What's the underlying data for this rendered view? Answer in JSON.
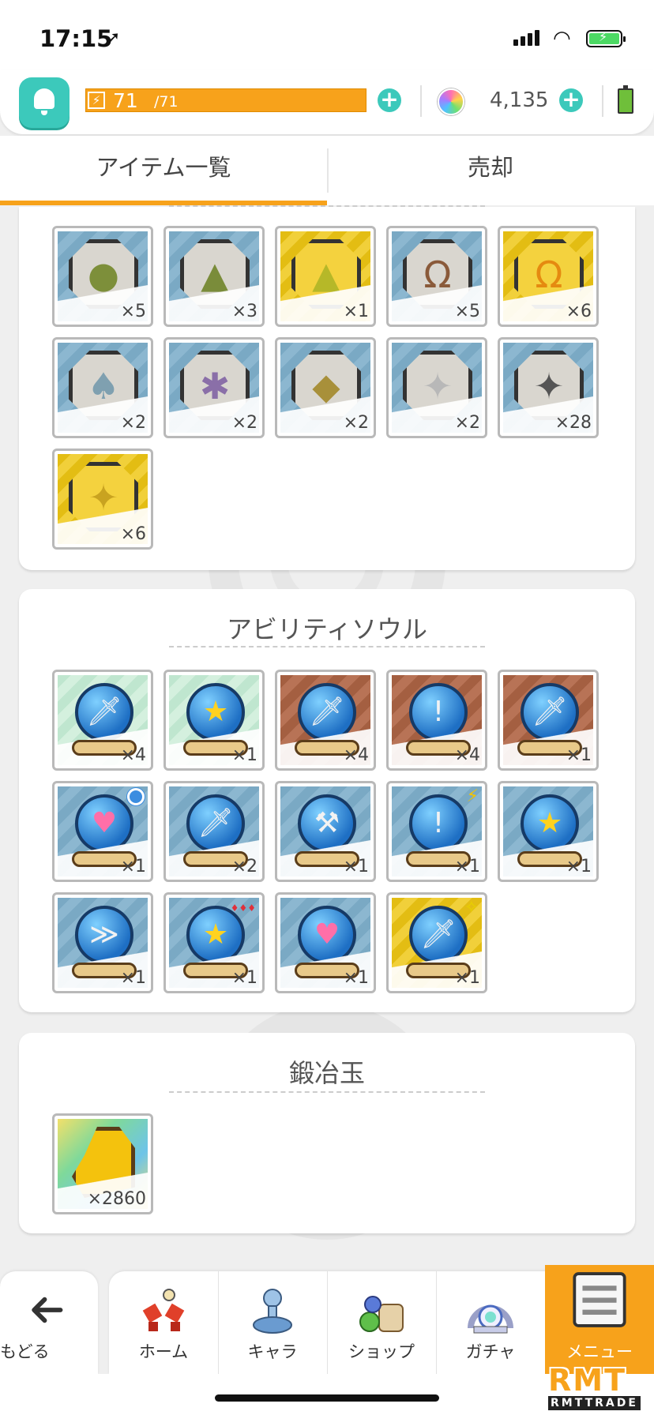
{
  "status": {
    "time": "17:15"
  },
  "header": {
    "stamina_current": "71",
    "stamina_max": "/71",
    "stamina_fraction": 1.0,
    "orb_count": "4,135"
  },
  "tabs": [
    {
      "label": "アイテム一覧",
      "active": true
    },
    {
      "label": "売却",
      "active": false
    }
  ],
  "medals": {
    "items": [
      {
        "bg": "blue",
        "count": "×5",
        "icon": "slime-medal-icon",
        "glyph": "●",
        "color": "#7d8f3a"
      },
      {
        "bg": "blue",
        "count": "×3",
        "icon": "squid-medal-icon",
        "glyph": "▲",
        "color": "#7a8c3a"
      },
      {
        "bg": "gold",
        "count": "×1",
        "icon": "squid-medal-icon",
        "glyph": "▲",
        "color": "#b6b828"
      },
      {
        "bg": "blue",
        "count": "×5",
        "icon": "mask-medal-icon",
        "glyph": "Ω",
        "color": "#8a5a3a"
      },
      {
        "bg": "gold",
        "count": "×6",
        "icon": "mask-medal-icon",
        "glyph": "Ω",
        "color": "#e58a10"
      },
      {
        "bg": "blue",
        "count": "×2",
        "icon": "ghost-medal-icon",
        "glyph": "♠",
        "color": "#7fa0b0"
      },
      {
        "bg": "blue",
        "count": "×2",
        "icon": "bat-medal-icon",
        "glyph": "✱",
        "color": "#8a6fa8"
      },
      {
        "bg": "blue",
        "count": "×2",
        "icon": "beast-medal-icon",
        "glyph": "◆",
        "color": "#a8903a"
      },
      {
        "bg": "blue",
        "count": "×2",
        "icon": "dragon-medal-icon",
        "glyph": "✦",
        "color": "#b8b8b8"
      },
      {
        "bg": "blue",
        "count": "×28",
        "icon": "dragon-medal-icon",
        "glyph": "✦",
        "color": "#555"
      },
      {
        "bg": "gold",
        "count": "×6",
        "icon": "dragon-medal-icon",
        "glyph": "✦",
        "color": "#c9a320"
      }
    ]
  },
  "ability_souls": {
    "title": "アビリティソウル",
    "items": [
      {
        "bg": "green",
        "count": "×4",
        "icon": "sword-soul-icon",
        "glyph": "🗡",
        "badge": ""
      },
      {
        "bg": "green",
        "count": "×1",
        "icon": "star-soul-icon",
        "glyph": "★",
        "badge": ""
      },
      {
        "bg": "bronze",
        "count": "×4",
        "icon": "sword-soul-icon",
        "glyph": "🗡",
        "badge": ""
      },
      {
        "bg": "bronze",
        "count": "×4",
        "icon": "mace-soul-icon",
        "glyph": "!",
        "badge": ""
      },
      {
        "bg": "bronze",
        "count": "×1",
        "icon": "sword-soul-icon",
        "glyph": "🗡",
        "badge": ""
      },
      {
        "bg": "blue",
        "count": "×1",
        "icon": "heart-soul-icon",
        "glyph": "♥",
        "badge": "dot"
      },
      {
        "bg": "blue",
        "count": "×2",
        "icon": "sword-soul-icon",
        "glyph": "🗡",
        "badge": ""
      },
      {
        "bg": "blue",
        "count": "×1",
        "icon": "axe-soul-icon",
        "glyph": "⚒",
        "badge": ""
      },
      {
        "bg": "blue",
        "count": "×1",
        "icon": "mace-soul-icon",
        "glyph": "!",
        "badge": "⚡"
      },
      {
        "bg": "blue",
        "count": "×1",
        "icon": "star-soul-icon",
        "glyph": "★",
        "badge": ""
      },
      {
        "bg": "blue",
        "count": "×1",
        "icon": "claw-soul-icon",
        "glyph": "≫",
        "badge": ""
      },
      {
        "bg": "blue",
        "count": "×1",
        "icon": "star-soul-icon",
        "glyph": "★",
        "badge": "♦♦♦"
      },
      {
        "bg": "blue",
        "count": "×1",
        "icon": "heart-soul-icon",
        "glyph": "♥",
        "badge": ""
      },
      {
        "bg": "gold",
        "count": "×1",
        "icon": "sword-soul-icon",
        "glyph": "🗡",
        "badge": "✧"
      }
    ]
  },
  "forge": {
    "title": "鍛冶玉",
    "items": [
      {
        "bg": "rainbow",
        "count": "×2860",
        "icon": "hammer-icon"
      }
    ]
  },
  "nav": {
    "back": "もどる",
    "items": [
      {
        "label": "ホーム",
        "icon": "home-icon"
      },
      {
        "label": "キャラ",
        "icon": "character-icon"
      },
      {
        "label": "ショップ",
        "icon": "shop-icon"
      },
      {
        "label": "ガチャ",
        "icon": "gacha-icon"
      },
      {
        "label": "メニュー",
        "icon": "menu-icon"
      }
    ]
  },
  "watermark": {
    "line1": "RMT",
    "line2": "RMTTRADE"
  }
}
